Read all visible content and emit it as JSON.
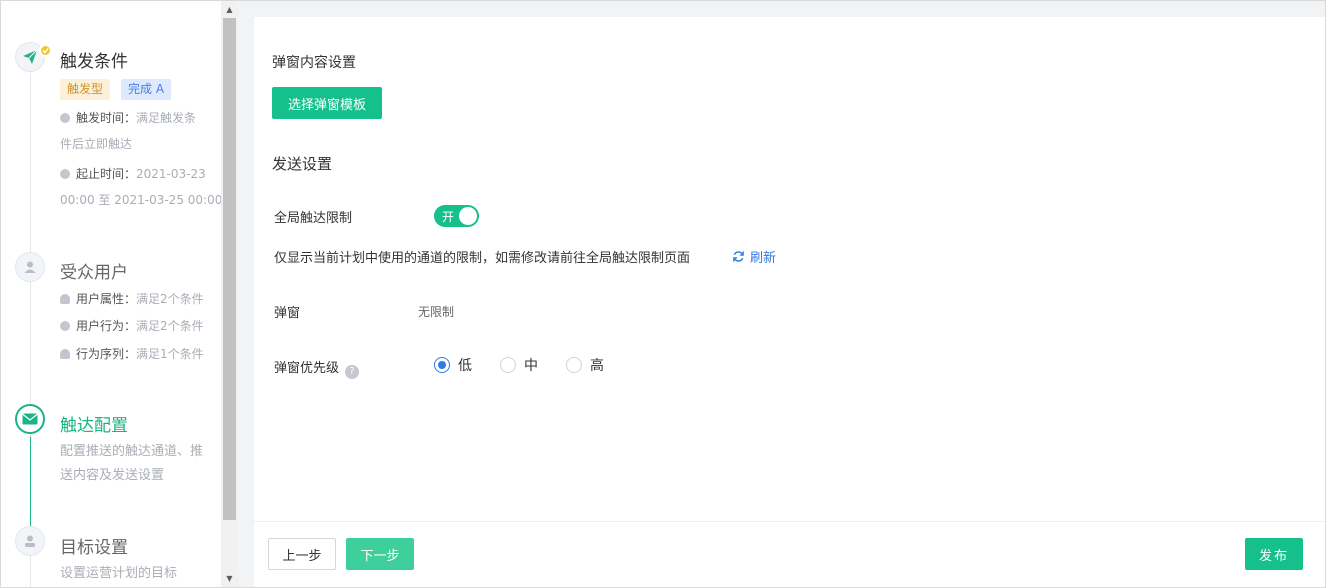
{
  "steps": [
    {
      "title": "触发条件",
      "icon": "paper-plane-icon",
      "tags": [
        "触发型",
        "完成 A"
      ],
      "info": [
        {
          "key": "触发时间：",
          "value": "满足触发条",
          "cont": "件后立即触达"
        },
        {
          "key": "起止时间：",
          "value": "2021-03-23",
          "cont": "00:00 至 2021-03-25 00:00"
        }
      ]
    },
    {
      "title": "受众用户",
      "icon": "users-icon",
      "info": [
        {
          "key": "用户属性：",
          "value": "满足2个条件"
        },
        {
          "key": "用户行为：",
          "value": "满足2个条件"
        },
        {
          "key": "行为序列：",
          "value": "满足1个条件"
        }
      ]
    },
    {
      "title": "触达配置",
      "icon": "envelope-icon",
      "desc": [
        "配置推送的触达通道、推",
        "送内容及发送设置"
      ]
    },
    {
      "title": "目标设置",
      "icon": "target-user-icon",
      "desc": [
        "设置运营计划的目标"
      ]
    }
  ],
  "content": {
    "popup_section_title": "弹窗内容设置",
    "select_template_label": "选择弹窗模板",
    "send_section_title": "发送设置",
    "global_limit_label": "全局触达限制",
    "toggle_text": "开",
    "hint_text": "仅显示当前计划中使用的通道的限制，如需修改请前往全局触达限制页面",
    "refresh_label": "刷新",
    "channel_label": "弹窗",
    "channel_value": "无限制",
    "priority_label": "弹窗优先级",
    "help_glyph": "?",
    "priority_options": [
      "低",
      "中",
      "高"
    ],
    "priority_selected": "低"
  },
  "footer": {
    "prev_label": "上一步",
    "next_label": "下一步",
    "publish_label": "发布"
  },
  "colors": {
    "accent": "#16c08a",
    "link": "#2f7ae5"
  }
}
